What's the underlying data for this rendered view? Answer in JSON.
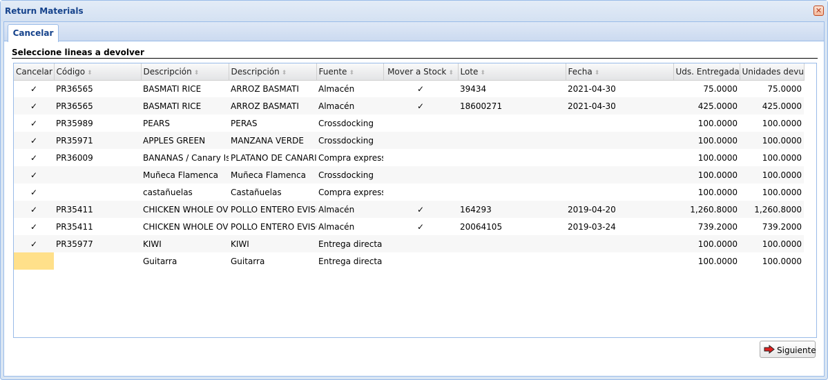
{
  "window": {
    "title": "Return Materials"
  },
  "tabs": [
    {
      "label": "Cancelar"
    }
  ],
  "section": {
    "title": "Seleccione lineas a devolver"
  },
  "grid": {
    "columns": [
      "Cancelar",
      "Código",
      "Descripción",
      "Descripción",
      "Fuente",
      "Mover a Stock",
      "Lote",
      "Fecha",
      "Uds. Entregadas",
      "Unidades devuel"
    ],
    "rows": [
      {
        "cancelar": "✓",
        "codigo": "PR36565",
        "desc1": "BASMATI RICE",
        "desc2": "ARROZ BASMATI",
        "fuente": "Almacén",
        "mover": "✓",
        "lote": "39434",
        "fecha": "2021-04-30",
        "entregadas": "75.0000",
        "devueltas": "75.0000"
      },
      {
        "cancelar": "✓",
        "codigo": "PR36565",
        "desc1": "BASMATI RICE",
        "desc2": "ARROZ BASMATI",
        "fuente": "Almacén",
        "mover": "✓",
        "lote": "18600271",
        "fecha": "2021-04-30",
        "entregadas": "425.0000",
        "devueltas": "425.0000"
      },
      {
        "cancelar": "✓",
        "codigo": "PR35989",
        "desc1": "PEARS",
        "desc2": "PERAS",
        "fuente": "Crossdocking",
        "mover": "",
        "lote": "",
        "fecha": "",
        "entregadas": "100.0000",
        "devueltas": "100.0000"
      },
      {
        "cancelar": "✓",
        "codigo": "PR35971",
        "desc1": "APPLES GREEN",
        "desc2": "MANZANA VERDE",
        "fuente": "Crossdocking",
        "mover": "",
        "lote": "",
        "fecha": "",
        "entregadas": "100.0000",
        "devueltas": "100.0000"
      },
      {
        "cancelar": "✓",
        "codigo": "PR36009",
        "desc1": "BANANAS / Canary Isla",
        "desc2": "PLATANO DE CANARIA",
        "fuente": "Compra express",
        "mover": "",
        "lote": "",
        "fecha": "",
        "entregadas": "100.0000",
        "devueltas": "100.0000"
      },
      {
        "cancelar": "✓",
        "codigo": "",
        "desc1": "Muñeca Flamenca",
        "desc2": "Muñeca Flamenca",
        "fuente": "Crossdocking",
        "mover": "",
        "lote": "",
        "fecha": "",
        "entregadas": "100.0000",
        "devueltas": "100.0000"
      },
      {
        "cancelar": "✓",
        "codigo": "",
        "desc1": "castañuelas",
        "desc2": "Castañuelas",
        "fuente": "Compra express",
        "mover": "",
        "lote": "",
        "fecha": "",
        "entregadas": "100.0000",
        "devueltas": "100.0000"
      },
      {
        "cancelar": "✓",
        "codigo": "PR35411",
        "desc1": "CHICKEN WHOLE OVEN",
        "desc2": "POLLO ENTERO EVISCE",
        "fuente": "Almacén",
        "mover": "✓",
        "lote": "164293",
        "fecha": "2019-04-20",
        "entregadas": "1,260.8000",
        "devueltas": "1,260.8000"
      },
      {
        "cancelar": "✓",
        "codigo": "PR35411",
        "desc1": "CHICKEN WHOLE OVEN",
        "desc2": "POLLO ENTERO EVISCE",
        "fuente": "Almacén",
        "mover": "✓",
        "lote": "20064105",
        "fecha": "2019-03-24",
        "entregadas": "739.2000",
        "devueltas": "739.2000"
      },
      {
        "cancelar": "✓",
        "codigo": "PR35977",
        "desc1": "KIWI",
        "desc2": "KIWI",
        "fuente": "Entrega directa",
        "mover": "",
        "lote": "",
        "fecha": "",
        "entregadas": "100.0000",
        "devueltas": "100.0000"
      },
      {
        "cancelar": "",
        "codigo": "",
        "desc1": "Guitarra",
        "desc2": "Guitarra",
        "fuente": "Entrega directa",
        "mover": "",
        "lote": "",
        "fecha": "",
        "entregadas": "100.0000",
        "devueltas": "100.0000"
      }
    ]
  },
  "footer": {
    "next_label": "Siguiente"
  },
  "colors": {
    "accent": "#15428b",
    "border": "#99bbe8",
    "selected_cell": "#ffe08a"
  },
  "icons": {
    "close": "close-icon",
    "next": "red-arrow-right-icon",
    "sort": "sort-icon"
  }
}
